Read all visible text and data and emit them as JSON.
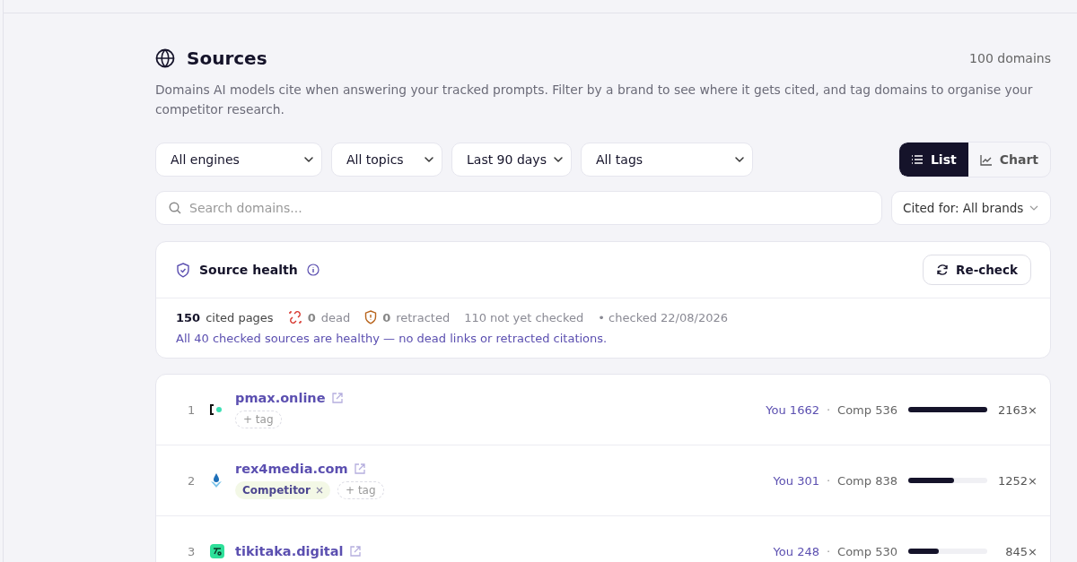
{
  "header": {
    "title": "Sources",
    "count": "100 domains",
    "description": "Domains AI models cite when answering your tracked prompts. Filter by a brand to see where it gets cited, and tag domains to organise your competitor research."
  },
  "filters": [
    {
      "label": "All engines"
    },
    {
      "label": "All topics"
    },
    {
      "label": "Last 90 days"
    },
    {
      "label": "All tags"
    }
  ],
  "views": [
    {
      "label": "List",
      "kind": "list",
      "selected": true
    },
    {
      "label": "Chart",
      "kind": "chart",
      "selected": false
    }
  ],
  "search": {
    "placeholder": "Search domains..."
  },
  "cited_for": "Cited for: All brands",
  "health": {
    "title": "Source health",
    "button": "Re-check",
    "stats": [
      {
        "kind": "count",
        "value": "150",
        "label": "cited pages"
      },
      {
        "kind": "dead",
        "value": "0",
        "label": "dead"
      },
      {
        "kind": "retracted",
        "value": "0",
        "label": "retracted"
      },
      {
        "kind": "plain",
        "label": "110 not yet checked"
      },
      {
        "kind": "plain",
        "label": "• checked 22/08/2026"
      }
    ],
    "message": "All 40 checked sources are healthy — no dead links or retracted citations."
  },
  "domains": [
    {
      "rank": "1",
      "name": "pmax.online",
      "kind": "bracket",
      "add_tag": "+ tag",
      "you": "You 1662",
      "separator": "·",
      "comp": "Comp 536",
      "level": 1.0,
      "total": "2163×"
    },
    {
      "rank": "2",
      "name": "rex4media.com",
      "kind": "drop",
      "tags": [
        {
          "label": "Competitor"
        }
      ],
      "add_tag": "+ tag",
      "you": "You 301",
      "separator": "·",
      "comp": "Comp 838",
      "level": 0.58,
      "total": "1252×"
    },
    {
      "rank": "3",
      "name": "tikitaka.digital",
      "kind": "badge",
      "you": "You 248",
      "separator": "·",
      "comp": "Comp 530",
      "level": 0.39,
      "total": "845×"
    }
  ]
}
